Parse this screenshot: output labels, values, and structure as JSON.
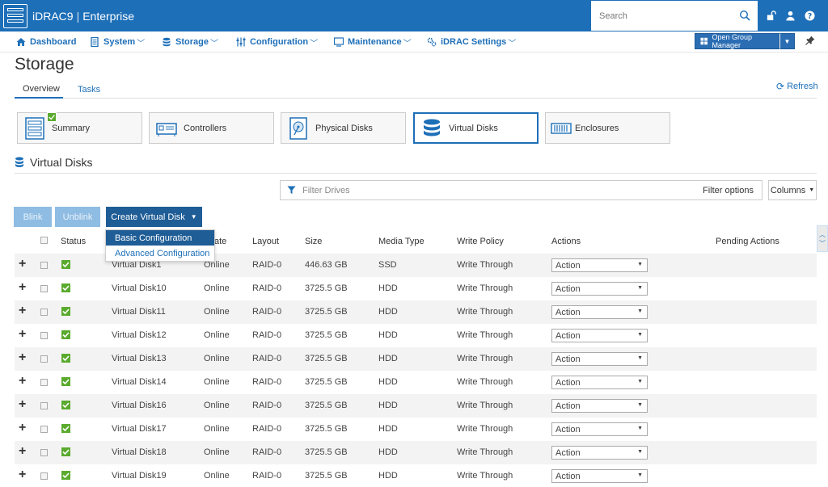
{
  "header": {
    "brand": "iDRAC9",
    "edition": "Enterprise",
    "search_placeholder": "Search",
    "colors": {
      "topbar": "#1d6fb8",
      "primary_button": "#1f5d96",
      "status_ok": "#5aaa2e"
    }
  },
  "nav": {
    "items": [
      {
        "label": "Dashboard",
        "icon": "home-icon",
        "has_dropdown": false
      },
      {
        "label": "System",
        "icon": "server-icon",
        "has_dropdown": true
      },
      {
        "label": "Storage",
        "icon": "database-icon",
        "has_dropdown": true
      },
      {
        "label": "Configuration",
        "icon": "sliders-icon",
        "has_dropdown": true
      },
      {
        "label": "Maintenance",
        "icon": "monitor-icon",
        "has_dropdown": true
      },
      {
        "label": "iDRAC Settings",
        "icon": "gears-icon",
        "has_dropdown": true
      }
    ],
    "group_manager": "Open Group Manager"
  },
  "page": {
    "title": "Storage",
    "tabs": [
      "Overview",
      "Tasks"
    ],
    "active_tab": "Overview",
    "refresh": "Refresh"
  },
  "tiles": [
    {
      "label": "Summary",
      "icon": "summary-icon"
    },
    {
      "label": "Controllers",
      "icon": "controller-icon"
    },
    {
      "label": "Physical Disks",
      "icon": "physical-disk-icon"
    },
    {
      "label": "Virtual Disks",
      "icon": "database-icon",
      "active": true
    },
    {
      "label": "Enclosures",
      "icon": "enclosure-icon"
    }
  ],
  "section": {
    "title": "Virtual Disks",
    "filter_placeholder": "Filter Drives",
    "filter_options": "Filter options",
    "columns": "Columns"
  },
  "buttons": {
    "blink": "Blink",
    "unblink": "Unblink",
    "create": "Create Virtual Disk"
  },
  "dropdown": {
    "items": [
      "Basic Configuration",
      "Advanced Configuration"
    ],
    "highlighted": "Basic Configuration"
  },
  "table": {
    "headers": {
      "status": "Status",
      "state": "ate",
      "layout": "Layout",
      "size": "Size",
      "media_type": "Media Type",
      "write_policy": "Write Policy",
      "actions": "Actions",
      "pending": "Pending Actions"
    },
    "rows": [
      {
        "name": "Virtual Disk1",
        "state": "Online",
        "layout": "RAID-0",
        "size": "446.63 GB",
        "media": "SSD",
        "policy": "Write Through",
        "action": "Action"
      },
      {
        "name": "Virtual Disk10",
        "state": "Online",
        "layout": "RAID-0",
        "size": "3725.5 GB",
        "media": "HDD",
        "policy": "Write Through",
        "action": "Action"
      },
      {
        "name": "Virtual Disk11",
        "state": "Online",
        "layout": "RAID-0",
        "size": "3725.5 GB",
        "media": "HDD",
        "policy": "Write Through",
        "action": "Action"
      },
      {
        "name": "Virtual Disk12",
        "state": "Online",
        "layout": "RAID-0",
        "size": "3725.5 GB",
        "media": "HDD",
        "policy": "Write Through",
        "action": "Action"
      },
      {
        "name": "Virtual Disk13",
        "state": "Online",
        "layout": "RAID-0",
        "size": "3725.5 GB",
        "media": "HDD",
        "policy": "Write Through",
        "action": "Action"
      },
      {
        "name": "Virtual Disk14",
        "state": "Online",
        "layout": "RAID-0",
        "size": "3725.5 GB",
        "media": "HDD",
        "policy": "Write Through",
        "action": "Action"
      },
      {
        "name": "Virtual Disk16",
        "state": "Online",
        "layout": "RAID-0",
        "size": "3725.5 GB",
        "media": "HDD",
        "policy": "Write Through",
        "action": "Action"
      },
      {
        "name": "Virtual Disk17",
        "state": "Online",
        "layout": "RAID-0",
        "size": "3725.5 GB",
        "media": "HDD",
        "policy": "Write Through",
        "action": "Action"
      },
      {
        "name": "Virtual Disk18",
        "state": "Online",
        "layout": "RAID-0",
        "size": "3725.5 GB",
        "media": "HDD",
        "policy": "Write Through",
        "action": "Action"
      },
      {
        "name": "Virtual Disk19",
        "state": "Online",
        "layout": "RAID-0",
        "size": "3725.5 GB",
        "media": "HDD",
        "policy": "Write Through",
        "action": "Action"
      }
    ]
  }
}
